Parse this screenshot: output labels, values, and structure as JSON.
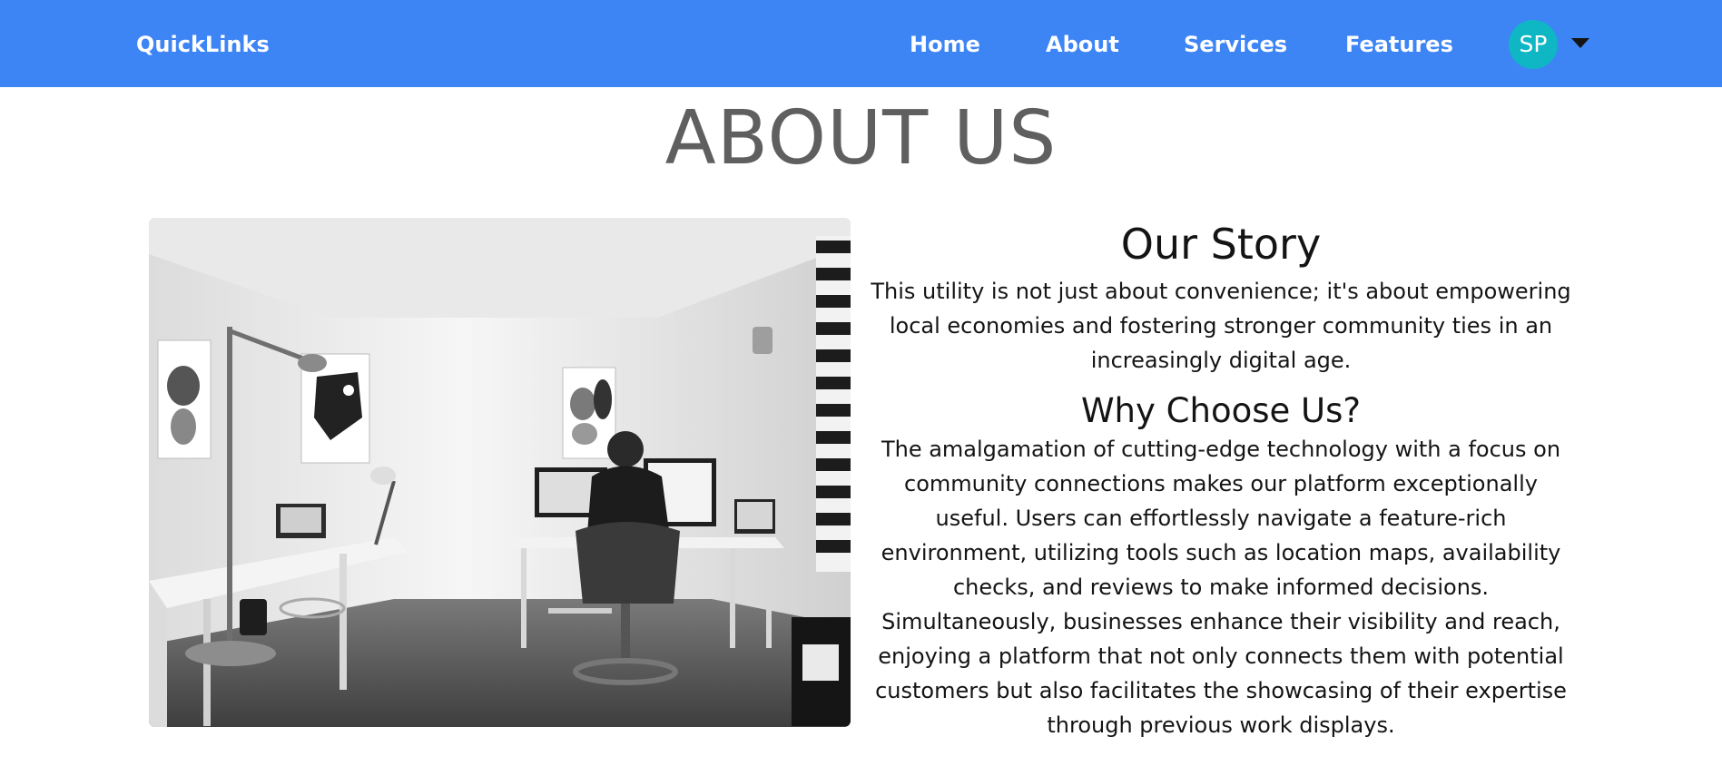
{
  "navbar": {
    "brand": "QuickLinks",
    "links": [
      "Home",
      "About",
      "Services",
      "Features"
    ],
    "avatar_initials": "SP",
    "accent_color": "#3d84f5",
    "avatar_color": "#0fb6c4"
  },
  "page": {
    "title": "ABOUT US"
  },
  "story": {
    "title": "Our Story",
    "body": "This utility is not just about convenience; it's about empowering local economies and fostering stronger community ties in an increasingly digital age."
  },
  "why": {
    "title": "Why Choose Us?",
    "body": "The amalgamation of cutting-edge technology with a focus on community connections makes our platform exceptionally useful. Users can effortlessly navigate a feature-rich environment, utilizing tools such as location maps, availability checks, and reviews to make informed decisions. Simultaneously, businesses enhance their visibility and reach, enjoying a platform that not only connects them with potential customers but also facilitates the showcasing of their expertise through previous work displays."
  },
  "icons": {
    "dropdown": "caret-down-icon"
  }
}
